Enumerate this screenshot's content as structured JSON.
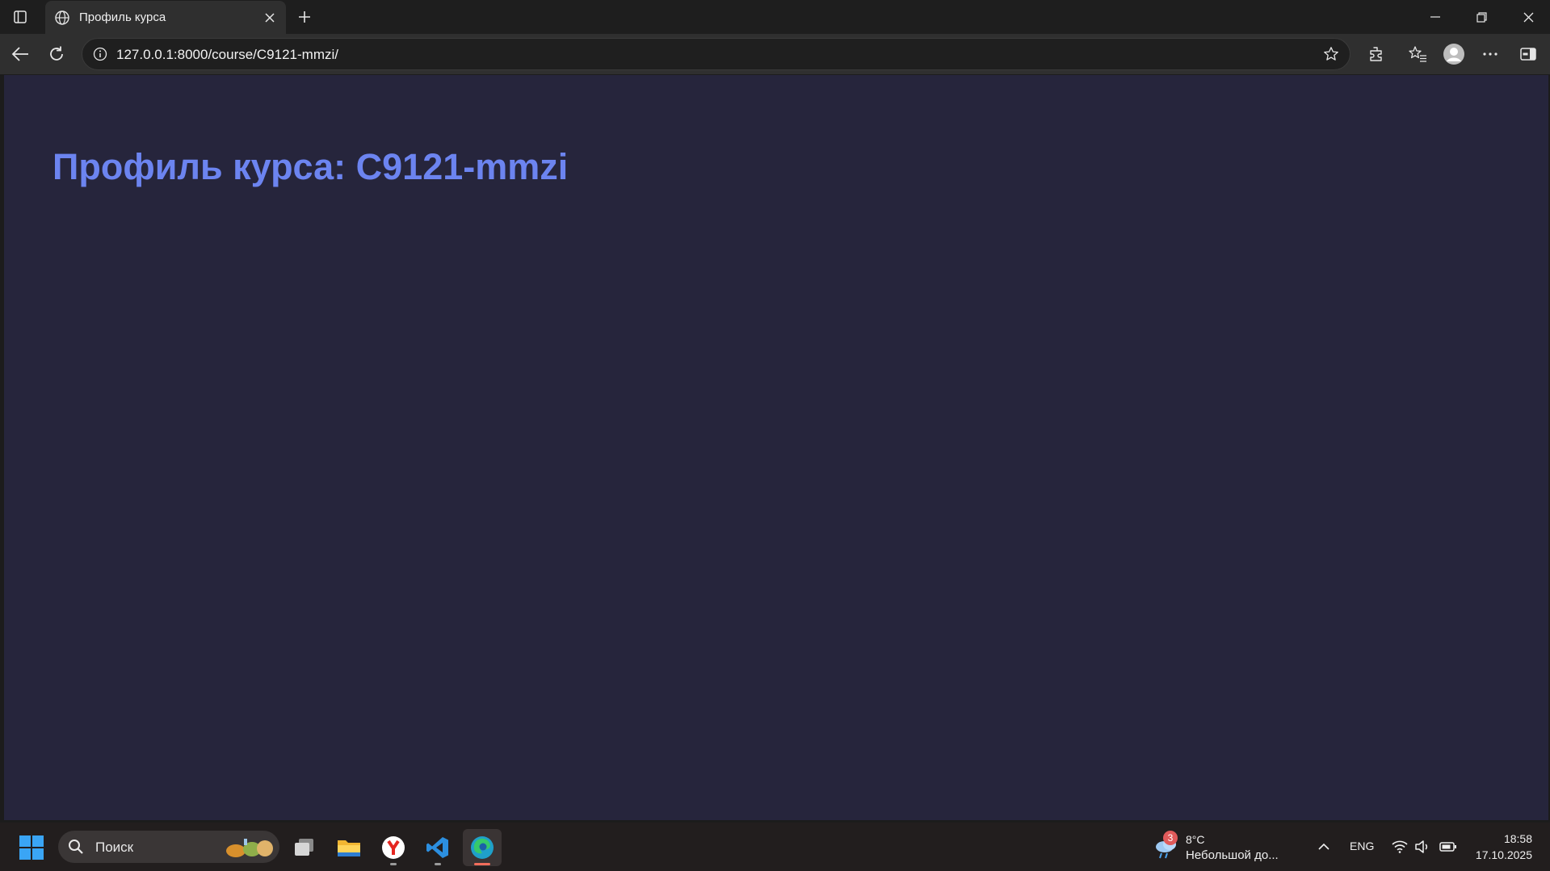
{
  "browser": {
    "tab": {
      "title": "Профиль курса"
    },
    "url": "127.0.0.1:8000/course/C9121-mmzi/"
  },
  "page": {
    "heading": "Профиль курса: C9121-mmzi",
    "background_color": "#26253c",
    "heading_color": "#6c84f0"
  },
  "taskbar": {
    "search_text": "Поиск",
    "weather": {
      "badge": "3",
      "temp": "8°C",
      "desc": "Небольшой до..."
    },
    "language": "ENG",
    "time": "18:58",
    "date": "17.10.2025",
    "apps": [
      "task-view",
      "file-explorer",
      "yandex-browser",
      "vscode",
      "edge"
    ]
  }
}
